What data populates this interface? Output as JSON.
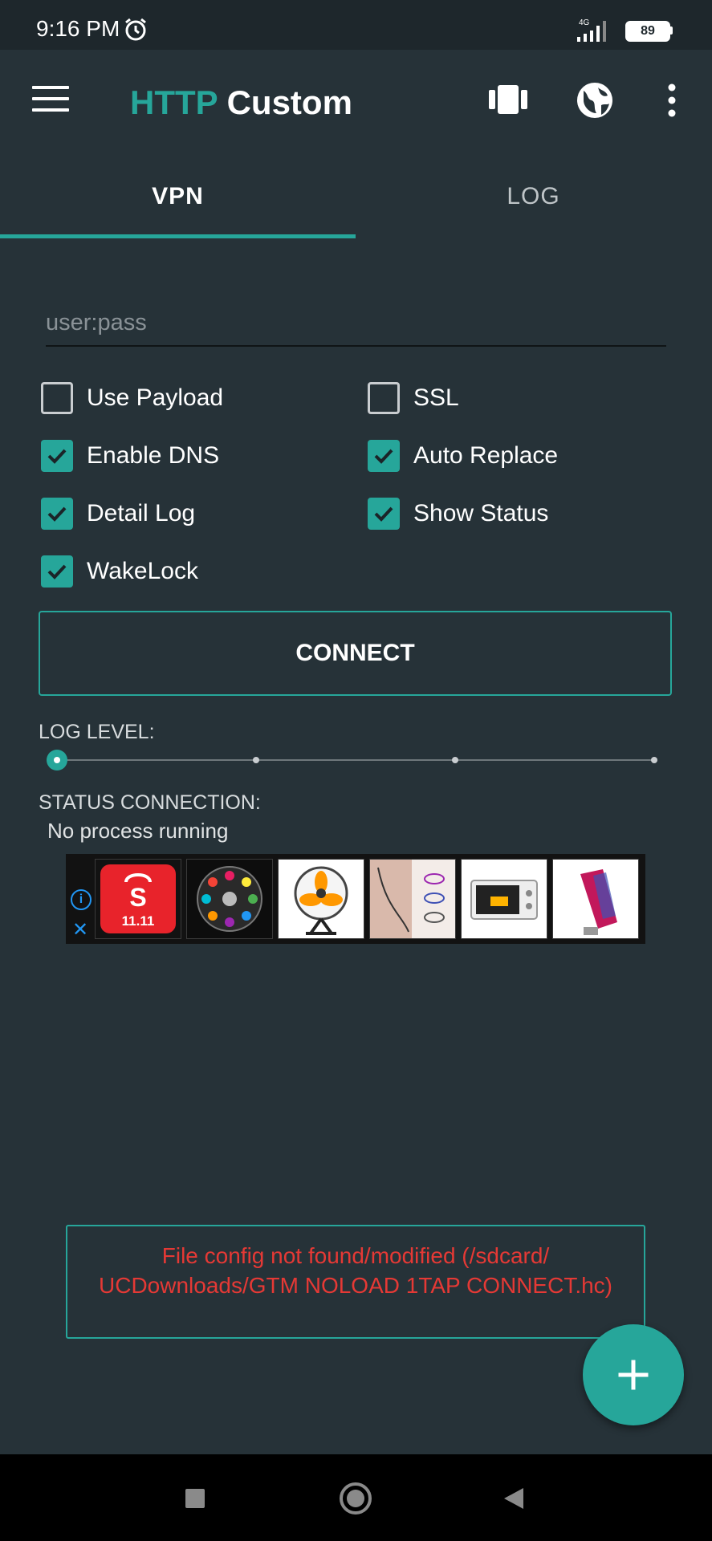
{
  "status_bar": {
    "time": "9:16 PM",
    "network": "4G",
    "battery": "89"
  },
  "app_bar": {
    "title_part1": "HTTP",
    "title_part2": "Custom"
  },
  "tabs": [
    {
      "label": "VPN",
      "active": true
    },
    {
      "label": "LOG",
      "active": false
    }
  ],
  "auth_input": {
    "placeholder": "user:pass",
    "value": ""
  },
  "options": [
    {
      "label": "Use Payload",
      "checked": false
    },
    {
      "label": "SSL",
      "checked": false
    },
    {
      "label": "Enable DNS",
      "checked": true
    },
    {
      "label": "Auto Replace",
      "checked": true
    },
    {
      "label": "Detail Log",
      "checked": true
    },
    {
      "label": "Show Status",
      "checked": true
    },
    {
      "label": "WakeLock",
      "checked": true
    }
  ],
  "connect_button": {
    "label": "CONNECT"
  },
  "log_level": {
    "label": "LOG LEVEL:",
    "value": 0,
    "steps": 4
  },
  "status_connection": {
    "label": "STATUS CONNECTION:",
    "value": "No process running"
  },
  "ad_banner": {
    "badge_text": "11.11"
  },
  "error_message": {
    "text": "File config not found/modified (/sdcard/ UCDownloads/GTM NOLOAD 1TAP CONNECT.hc)"
  },
  "colors": {
    "accent": "#26a69a",
    "background": "#263238",
    "error": "#e53935"
  }
}
